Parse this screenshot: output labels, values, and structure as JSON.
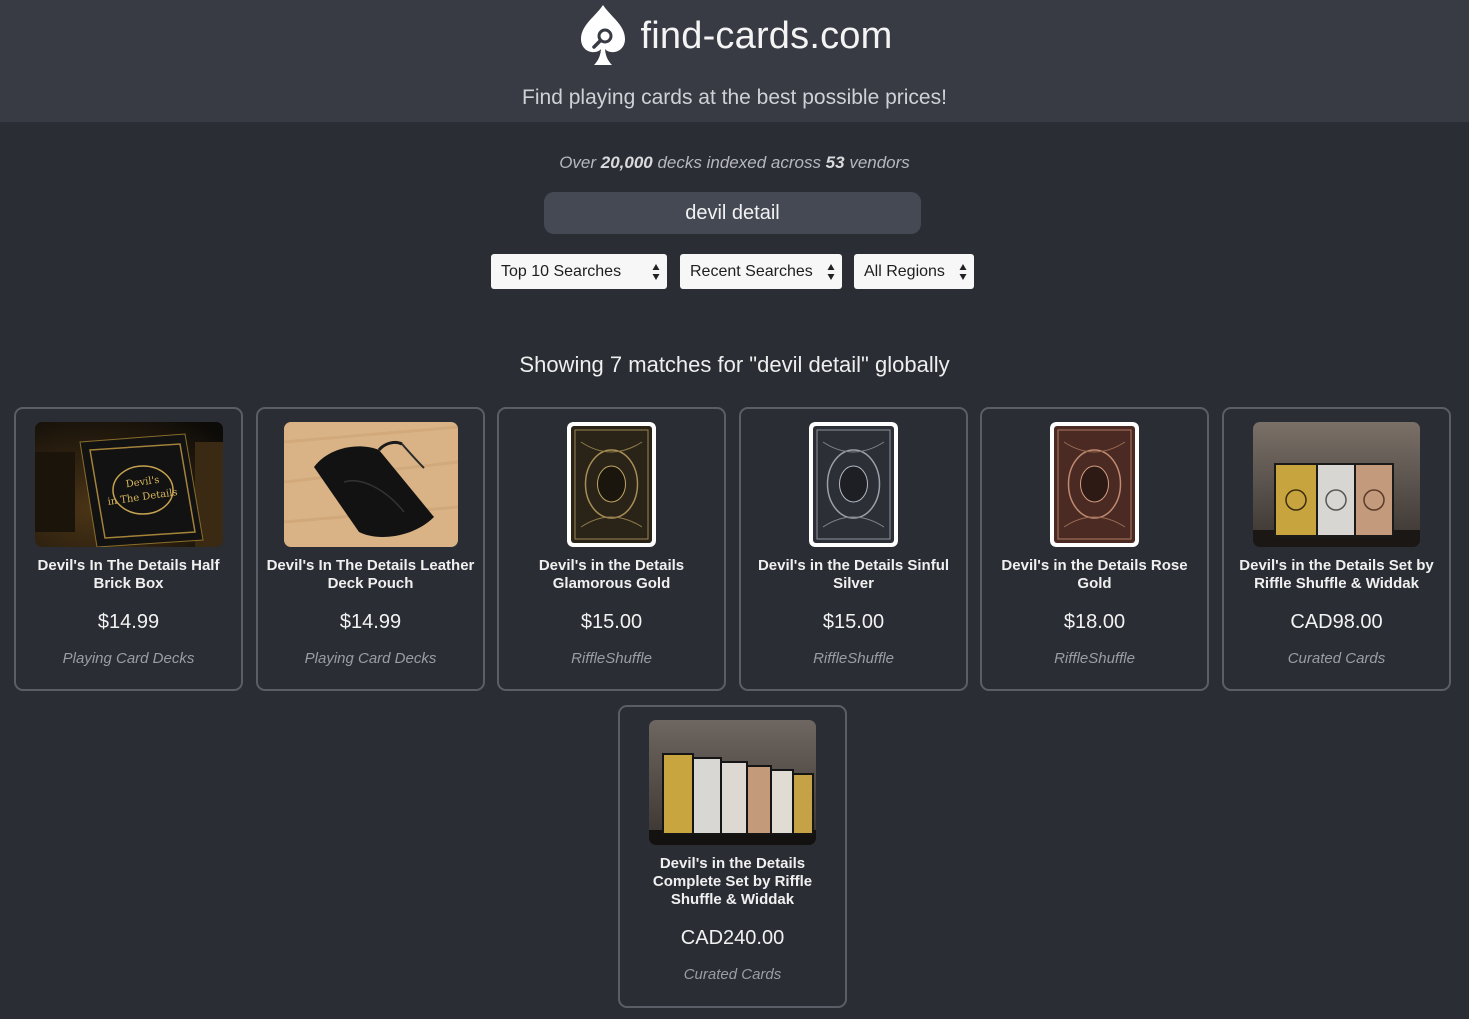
{
  "header": {
    "site_name": "find-cards.com",
    "tagline": "Find playing cards at the best possible prices!"
  },
  "stats": {
    "prefix": "Over ",
    "deck_count": "20,000",
    "middle": " decks indexed across ",
    "vendor_count": "53",
    "suffix": " vendors"
  },
  "search": {
    "value": "devil detail"
  },
  "filters": {
    "top_searches": "Top 10 Searches",
    "recent_searches": "Recent Searches",
    "region": "All Regions"
  },
  "results_title": "Showing 7 matches for \"devil detail\" globally",
  "products": [
    {
      "name": "Devil's In The Details Half Brick Box",
      "price": "$14.99",
      "vendor": "Playing Card Decks",
      "image": "black-gold-box-image"
    },
    {
      "name": "Devil's In The Details Leather Deck Pouch",
      "price": "$14.99",
      "vendor": "Playing Card Decks",
      "image": "leather-pouch-image"
    },
    {
      "name": "Devil's in the Details Glamorous Gold",
      "price": "$15.00",
      "vendor": "RiffleShuffle",
      "image": "gold-card-back-image"
    },
    {
      "name": "Devil's in the Details Sinful Silver",
      "price": "$15.00",
      "vendor": "RiffleShuffle",
      "image": "silver-card-back-image"
    },
    {
      "name": "Devil's in the Details Rose Gold",
      "price": "$18.00",
      "vendor": "RiffleShuffle",
      "image": "rose-gold-card-back-image"
    },
    {
      "name": "Devil's in the Details Set by Riffle Shuffle & Widdak",
      "price": "CAD98.00",
      "vendor": "Curated Cards",
      "image": "deck-set-image"
    },
    {
      "name": "Devil's in the Details Complete Set by Riffle Shuffle & Widdak",
      "price": "CAD240.00",
      "vendor": "Curated Cards",
      "image": "complete-set-image"
    }
  ],
  "colors": {
    "background": "#2a2d33",
    "header": "#383b44",
    "card_border": "#5b5e66",
    "search_bg": "#454953"
  }
}
